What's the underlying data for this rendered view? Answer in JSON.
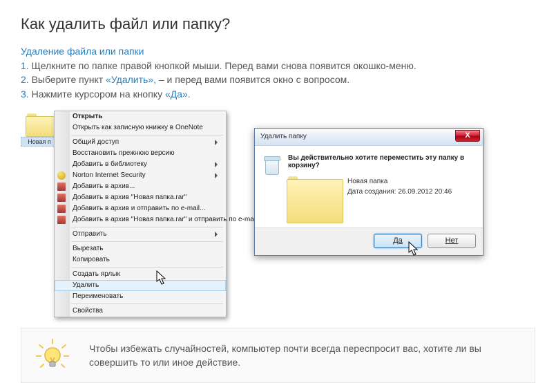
{
  "title": "Как удалить файл или папку?",
  "subtitle": "Удаление файла или папки",
  "steps": [
    {
      "num": "1.",
      "pre": "Щелкните по папке правой кнопкой мыши. Перед вами снова появится окошко-меню.",
      "hl": "",
      "post": ""
    },
    {
      "num": "2.",
      "pre": "Выберите пункт ",
      "hl": "«Удалить»,",
      "post": " – и перед вами появится окно с вопросом."
    },
    {
      "num": "3.",
      "pre": "Нажмите курсором на кнопку ",
      "hl": "«Да».",
      "post": ""
    }
  ],
  "folder_chip_label": "Новая п",
  "context_menu": [
    {
      "label": "Открыть",
      "bold": true
    },
    {
      "label": "Открыть как записную книжку в OneNote",
      "icon": ""
    },
    {
      "sep": true
    },
    {
      "label": "Общий доступ",
      "sub": true
    },
    {
      "label": "Восстановить прежнюю версию"
    },
    {
      "label": "Добавить в библиотеку",
      "sub": true
    },
    {
      "label": "Norton Internet Security",
      "sub": true,
      "icon": "yellow"
    },
    {
      "label": "Добавить в архив...",
      "icon": "book"
    },
    {
      "label": "Добавить в архив \"Новая папка.rar\"",
      "icon": "book"
    },
    {
      "label": "Добавить в архив и отправить по e-mail...",
      "icon": "book"
    },
    {
      "label": "Добавить в архив \"Новая папка.rar\" и отправить по e-mail",
      "icon": "book"
    },
    {
      "sep": true
    },
    {
      "label": "Отправить",
      "sub": true
    },
    {
      "sep": true
    },
    {
      "label": "Вырезать"
    },
    {
      "label": "Копировать"
    },
    {
      "sep": true
    },
    {
      "label": "Создать ярлык"
    },
    {
      "label": "Удалить",
      "hover": true
    },
    {
      "label": "Переименовать"
    },
    {
      "sep": true
    },
    {
      "label": "Свойства"
    }
  ],
  "dialog": {
    "title": "Удалить папку",
    "close_glyph": "X",
    "question": "Вы действительно хотите переместить эту папку в корзину?",
    "name": "Новая папка",
    "date_label": "Дата создания: 26.09.2012 20:46",
    "yes": "Да",
    "no": "Нет"
  },
  "tip": "Чтобы избежать случайностей, компьютер почти всегда переспросит вас, хотите ли вы совершить то или иное действие."
}
